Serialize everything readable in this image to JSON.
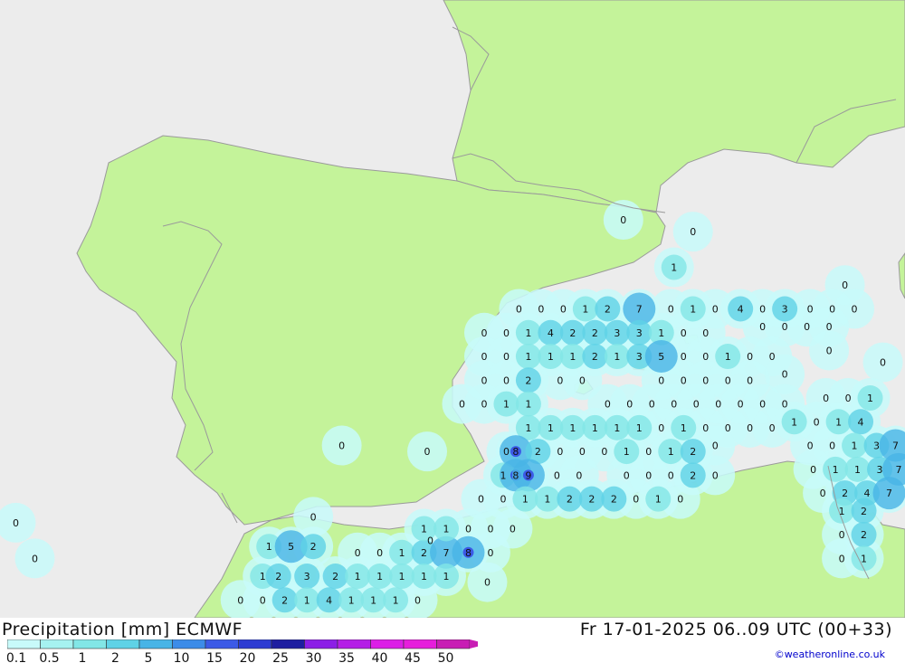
{
  "footer": {
    "title_left": "Precipitation [mm] ECMWF",
    "title_right": "Fr 17-01-2025 06..09 UTC (00+33)",
    "credit": "©weatheronline.co.uk"
  },
  "colors": {
    "sea": "#ececec",
    "land": "#c4f39a",
    "border": "#9a9a9a"
  },
  "legend": {
    "labels": [
      "0.1",
      "0.5",
      "1",
      "2",
      "5",
      "10",
      "15",
      "20",
      "25",
      "30",
      "35",
      "40",
      "45",
      "50"
    ],
    "colors": [
      "#c8fafa",
      "#a6f2f0",
      "#82e6e6",
      "#5fd2e6",
      "#48b4e6",
      "#3c8ce8",
      "#3c5ae6",
      "#2d3cd2",
      "#1e1ea0",
      "#8c1ee6",
      "#b41ee6",
      "#dc1ee6",
      "#e61edc",
      "#c81eb4"
    ]
  },
  "map_values": [
    {
      "label": "0",
      "lon": 1.1,
      "lat": 42.0
    },
    {
      "label": "0",
      "lon": 3.3,
      "lat": 41.8
    },
    {
      "label": "0",
      "lon": 8.1,
      "lat": 40.9
    },
    {
      "label": "1",
      "lon": 2.7,
      "lat": 41.2
    },
    {
      "label": "0",
      "lon": -2.2,
      "lat": 40.5
    },
    {
      "label": "0",
      "lon": -1.5,
      "lat": 40.5
    },
    {
      "label": "0",
      "lon": -0.8,
      "lat": 40.5
    },
    {
      "label": "1",
      "lon": -0.1,
      "lat": 40.5
    },
    {
      "label": "2",
      "lon": 0.6,
      "lat": 40.5
    },
    {
      "label": "7",
      "lon": 1.6,
      "lat": 40.5
    },
    {
      "label": "0",
      "lon": 2.6,
      "lat": 40.5
    },
    {
      "label": "1",
      "lon": 3.3,
      "lat": 40.5
    },
    {
      "label": "0",
      "lon": 4.0,
      "lat": 40.5
    },
    {
      "label": "4",
      "lon": 4.8,
      "lat": 40.5
    },
    {
      "label": "0",
      "lon": 5.5,
      "lat": 40.5
    },
    {
      "label": "3",
      "lon": 6.2,
      "lat": 40.5
    },
    {
      "label": "0",
      "lon": 7.0,
      "lat": 40.5
    },
    {
      "label": "0",
      "lon": 7.7,
      "lat": 40.5
    },
    {
      "label": "0",
      "lon": 8.4,
      "lat": 40.5
    },
    {
      "label": "0",
      "lon": -3.3,
      "lat": 40.1
    },
    {
      "label": "0",
      "lon": -2.6,
      "lat": 40.1
    },
    {
      "label": "1",
      "lon": -1.9,
      "lat": 40.1
    },
    {
      "label": "4",
      "lon": -1.2,
      "lat": 40.1
    },
    {
      "label": "2",
      "lon": -0.5,
      "lat": 40.1
    },
    {
      "label": "2",
      "lon": 0.2,
      "lat": 40.1
    },
    {
      "label": "3",
      "lon": 0.9,
      "lat": 40.1
    },
    {
      "label": "3",
      "lon": 1.6,
      "lat": 40.1
    },
    {
      "label": "1",
      "lon": 2.3,
      "lat": 40.1
    },
    {
      "label": "0",
      "lon": 3.0,
      "lat": 40.1
    },
    {
      "label": "0",
      "lon": 3.7,
      "lat": 40.1
    },
    {
      "label": "0",
      "lon": 5.5,
      "lat": 40.2
    },
    {
      "label": "0",
      "lon": 6.2,
      "lat": 40.2
    },
    {
      "label": "0",
      "lon": 6.9,
      "lat": 40.2
    },
    {
      "label": "0",
      "lon": 7.6,
      "lat": 40.2
    },
    {
      "label": "0",
      "lon": -3.3,
      "lat": 39.7
    },
    {
      "label": "0",
      "lon": -2.6,
      "lat": 39.7
    },
    {
      "label": "1",
      "lon": -1.9,
      "lat": 39.7
    },
    {
      "label": "1",
      "lon": -1.2,
      "lat": 39.7
    },
    {
      "label": "1",
      "lon": -0.5,
      "lat": 39.7
    },
    {
      "label": "2",
      "lon": 0.2,
      "lat": 39.7
    },
    {
      "label": "1",
      "lon": 0.9,
      "lat": 39.7
    },
    {
      "label": "3",
      "lon": 1.6,
      "lat": 39.7
    },
    {
      "label": "5",
      "lon": 2.3,
      "lat": 39.7
    },
    {
      "label": "0",
      "lon": 3.0,
      "lat": 39.7
    },
    {
      "label": "0",
      "lon": 3.7,
      "lat": 39.7
    },
    {
      "label": "1",
      "lon": 4.4,
      "lat": 39.7
    },
    {
      "label": "0",
      "lon": 5.1,
      "lat": 39.7
    },
    {
      "label": "0",
      "lon": 5.8,
      "lat": 39.7
    },
    {
      "label": "0",
      "lon": 7.6,
      "lat": 39.8
    },
    {
      "label": "0",
      "lon": -3.3,
      "lat": 39.3
    },
    {
      "label": "0",
      "lon": -2.6,
      "lat": 39.3
    },
    {
      "label": "2",
      "lon": -1.9,
      "lat": 39.3
    },
    {
      "label": "0",
      "lon": -0.9,
      "lat": 39.3
    },
    {
      "label": "0",
      "lon": -0.2,
      "lat": 39.3
    },
    {
      "label": "0",
      "lon": 2.3,
      "lat": 39.3
    },
    {
      "label": "0",
      "lon": 3.0,
      "lat": 39.3
    },
    {
      "label": "0",
      "lon": 3.7,
      "lat": 39.3
    },
    {
      "label": "0",
      "lon": 4.4,
      "lat": 39.3
    },
    {
      "label": "0",
      "lon": 5.1,
      "lat": 39.3
    },
    {
      "label": "0",
      "lon": 6.2,
      "lat": 39.4
    },
    {
      "label": "0",
      "lon": 9.3,
      "lat": 39.6
    },
    {
      "label": "0",
      "lon": -4.0,
      "lat": 38.9
    },
    {
      "label": "0",
      "lon": -3.3,
      "lat": 38.9
    },
    {
      "label": "1",
      "lon": -2.6,
      "lat": 38.9
    },
    {
      "label": "1",
      "lon": -1.9,
      "lat": 38.9
    },
    {
      "label": "0",
      "lon": 0.6,
      "lat": 38.9
    },
    {
      "label": "0",
      "lon": 1.3,
      "lat": 38.9
    },
    {
      "label": "0",
      "lon": 2.0,
      "lat": 38.9
    },
    {
      "label": "0",
      "lon": 2.7,
      "lat": 38.9
    },
    {
      "label": "0",
      "lon": 3.4,
      "lat": 38.9
    },
    {
      "label": "0",
      "lon": 4.1,
      "lat": 38.9
    },
    {
      "label": "0",
      "lon": 4.8,
      "lat": 38.9
    },
    {
      "label": "0",
      "lon": 5.5,
      "lat": 38.9
    },
    {
      "label": "0",
      "lon": 6.2,
      "lat": 38.9
    },
    {
      "label": "0",
      "lon": 7.5,
      "lat": 39.0
    },
    {
      "label": "0",
      "lon": 8.2,
      "lat": 39.0
    },
    {
      "label": "1",
      "lon": 8.9,
      "lat": 39.0
    },
    {
      "label": "1",
      "lon": -1.9,
      "lat": 38.5
    },
    {
      "label": "1",
      "lon": -1.2,
      "lat": 38.5
    },
    {
      "label": "1",
      "lon": -0.5,
      "lat": 38.5
    },
    {
      "label": "1",
      "lon": 0.2,
      "lat": 38.5
    },
    {
      "label": "1",
      "lon": 0.9,
      "lat": 38.5
    },
    {
      "label": "1",
      "lon": 1.6,
      "lat": 38.5
    },
    {
      "label": "0",
      "lon": 2.3,
      "lat": 38.5
    },
    {
      "label": "1",
      "lon": 3.0,
      "lat": 38.5
    },
    {
      "label": "0",
      "lon": 3.7,
      "lat": 38.5
    },
    {
      "label": "0",
      "lon": 4.4,
      "lat": 38.5
    },
    {
      "label": "0",
      "lon": 5.1,
      "lat": 38.5
    },
    {
      "label": "0",
      "lon": 5.8,
      "lat": 38.5
    },
    {
      "label": "1",
      "lon": 6.5,
      "lat": 38.6
    },
    {
      "label": "0",
      "lon": 7.2,
      "lat": 38.6
    },
    {
      "label": "1",
      "lon": 7.9,
      "lat": 38.6
    },
    {
      "label": "4",
      "lon": 8.6,
      "lat": 38.6
    },
    {
      "label": "0",
      "lon": 7.0,
      "lat": 38.2
    },
    {
      "label": "0",
      "lon": 7.7,
      "lat": 38.2
    },
    {
      "label": "1",
      "lon": 8.4,
      "lat": 38.2
    },
    {
      "label": "3",
      "lon": 9.1,
      "lat": 38.2
    },
    {
      "label": "7",
      "lon": 9.7,
      "lat": 38.2
    },
    {
      "label": "0",
      "lon": -2.6,
      "lat": 38.1
    },
    {
      "label": "8",
      "lon": -2.3,
      "lat": 38.1
    },
    {
      "label": "2",
      "lon": -1.6,
      "lat": 38.1
    },
    {
      "label": "0",
      "lon": -0.9,
      "lat": 38.1
    },
    {
      "label": "0",
      "lon": -0.2,
      "lat": 38.1
    },
    {
      "label": "0",
      "lon": 0.5,
      "lat": 38.1
    },
    {
      "label": "1",
      "lon": 1.2,
      "lat": 38.1
    },
    {
      "label": "0",
      "lon": 1.9,
      "lat": 38.1
    },
    {
      "label": "1",
      "lon": 2.6,
      "lat": 38.1
    },
    {
      "label": "2",
      "lon": 3.3,
      "lat": 38.1
    },
    {
      "label": "0",
      "lon": 4.0,
      "lat": 38.2
    },
    {
      "label": "0",
      "lon": 7.1,
      "lat": 37.8
    },
    {
      "label": "1",
      "lon": 7.8,
      "lat": 37.8
    },
    {
      "label": "1",
      "lon": 8.5,
      "lat": 37.8
    },
    {
      "label": "3",
      "lon": 9.2,
      "lat": 37.8
    },
    {
      "label": "7",
      "lon": 9.8,
      "lat": 37.8
    },
    {
      "label": "1",
      "lon": -2.7,
      "lat": 37.7
    },
    {
      "label": "8",
      "lon": -2.3,
      "lat": 37.7
    },
    {
      "label": "9",
      "lon": -1.9,
      "lat": 37.7
    },
    {
      "label": "0",
      "lon": -1.0,
      "lat": 37.7
    },
    {
      "label": "0",
      "lon": -0.3,
      "lat": 37.7
    },
    {
      "label": "0",
      "lon": 1.2,
      "lat": 37.7
    },
    {
      "label": "0",
      "lon": 1.9,
      "lat": 37.7
    },
    {
      "label": "0",
      "lon": 2.6,
      "lat": 37.7
    },
    {
      "label": "2",
      "lon": 3.3,
      "lat": 37.7
    },
    {
      "label": "0",
      "lon": 4.0,
      "lat": 37.7
    },
    {
      "label": "0",
      "lon": 7.4,
      "lat": 37.4
    },
    {
      "label": "2",
      "lon": 8.1,
      "lat": 37.4
    },
    {
      "label": "4",
      "lon": 8.8,
      "lat": 37.4
    },
    {
      "label": "7",
      "lon": 9.5,
      "lat": 37.4
    },
    {
      "label": "0",
      "lon": -3.4,
      "lat": 37.3
    },
    {
      "label": "0",
      "lon": -2.7,
      "lat": 37.3
    },
    {
      "label": "1",
      "lon": -2.0,
      "lat": 37.3
    },
    {
      "label": "1",
      "lon": -1.3,
      "lat": 37.3
    },
    {
      "label": "2",
      "lon": -0.6,
      "lat": 37.3
    },
    {
      "label": "2",
      "lon": 0.1,
      "lat": 37.3
    },
    {
      "label": "2",
      "lon": 0.8,
      "lat": 37.3
    },
    {
      "label": "0",
      "lon": 1.5,
      "lat": 37.3
    },
    {
      "label": "1",
      "lon": 2.2,
      "lat": 37.3
    },
    {
      "label": "0",
      "lon": 2.9,
      "lat": 37.3
    },
    {
      "label": "1",
      "lon": 8.0,
      "lat": 37.1
    },
    {
      "label": "2",
      "lon": 8.7,
      "lat": 37.1
    },
    {
      "label": "0",
      "lon": 8.0,
      "lat": 36.7
    },
    {
      "label": "2",
      "lon": 8.7,
      "lat": 36.7
    },
    {
      "label": "0",
      "lon": 8.0,
      "lat": 36.3
    },
    {
      "label": "1",
      "lon": 8.7,
      "lat": 36.3
    },
    {
      "label": "0",
      "lon": -18.1,
      "lat": 36.9
    },
    {
      "label": "0",
      "lon": -17.5,
      "lat": 36.3
    },
    {
      "label": "0",
      "lon": -8.7,
      "lat": 37.0
    },
    {
      "label": "0",
      "lon": -5.0,
      "lat": 36.6
    },
    {
      "label": "0",
      "lon": -7.8,
      "lat": 38.2
    },
    {
      "label": "0",
      "lon": -5.1,
      "lat": 38.1
    },
    {
      "label": "1",
      "lon": -10.1,
      "lat": 36.5
    },
    {
      "label": "5",
      "lon": -9.4,
      "lat": 36.5
    },
    {
      "label": "2",
      "lon": -8.7,
      "lat": 36.5
    },
    {
      "label": "0",
      "lon": -7.3,
      "lat": 36.4
    },
    {
      "label": "0",
      "lon": -6.6,
      "lat": 36.4
    },
    {
      "label": "1",
      "lon": -5.9,
      "lat": 36.4
    },
    {
      "label": "2",
      "lon": -5.2,
      "lat": 36.4
    },
    {
      "label": "7",
      "lon": -4.5,
      "lat": 36.4
    },
    {
      "label": "8",
      "lon": -3.8,
      "lat": 36.4
    },
    {
      "label": "0",
      "lon": -3.1,
      "lat": 36.4
    },
    {
      "label": "1",
      "lon": -5.2,
      "lat": 36.8
    },
    {
      "label": "1",
      "lon": -4.5,
      "lat": 36.8
    },
    {
      "label": "0",
      "lon": -3.8,
      "lat": 36.8
    },
    {
      "label": "0",
      "lon": -3.1,
      "lat": 36.8
    },
    {
      "label": "0",
      "lon": -2.4,
      "lat": 36.8
    },
    {
      "label": "1",
      "lon": -10.3,
      "lat": 36.0
    },
    {
      "label": "2",
      "lon": -9.8,
      "lat": 36.0
    },
    {
      "label": "3",
      "lon": -8.9,
      "lat": 36.0
    },
    {
      "label": "2",
      "lon": -8.0,
      "lat": 36.0
    },
    {
      "label": "1",
      "lon": -7.3,
      "lat": 36.0
    },
    {
      "label": "1",
      "lon": -6.6,
      "lat": 36.0
    },
    {
      "label": "1",
      "lon": -5.9,
      "lat": 36.0
    },
    {
      "label": "1",
      "lon": -5.2,
      "lat": 36.0
    },
    {
      "label": "1",
      "lon": -4.5,
      "lat": 36.0
    },
    {
      "label": "0",
      "lon": -3.2,
      "lat": 35.9
    },
    {
      "label": "0",
      "lon": -11.0,
      "lat": 35.6
    },
    {
      "label": "0",
      "lon": -10.3,
      "lat": 35.6
    },
    {
      "label": "2",
      "lon": -9.6,
      "lat": 35.6
    },
    {
      "label": "1",
      "lon": -8.9,
      "lat": 35.6
    },
    {
      "label": "4",
      "lon": -8.2,
      "lat": 35.6
    },
    {
      "label": "1",
      "lon": -7.5,
      "lat": 35.6
    },
    {
      "label": "1",
      "lon": -6.8,
      "lat": 35.6
    },
    {
      "label": "1",
      "lon": -6.1,
      "lat": 35.6
    },
    {
      "label": "0",
      "lon": -5.4,
      "lat": 35.6
    }
  ]
}
